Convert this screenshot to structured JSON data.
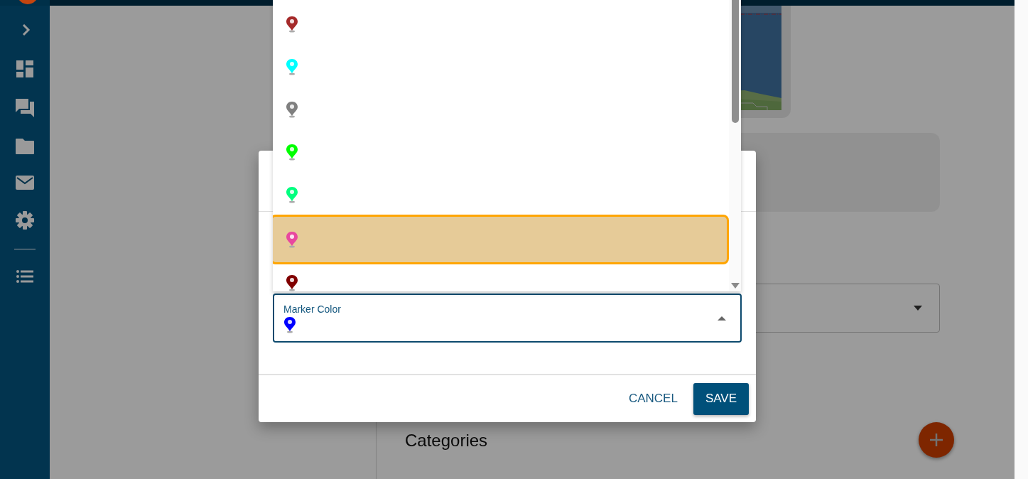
{
  "page": {
    "heading": "Categories"
  },
  "marker_dialog": {
    "options": [
      {
        "color": "#a52a2a",
        "selected": false,
        "highlighted": false
      },
      {
        "color": "#00ffff",
        "selected": false,
        "highlighted": false
      },
      {
        "color": "#808080",
        "selected": false,
        "highlighted": false
      },
      {
        "color": "#00ff00",
        "selected": false,
        "highlighted": false
      },
      {
        "color": "#00ff7f",
        "selected": false,
        "highlighted": false
      },
      {
        "color": "#e8489f",
        "selected": false,
        "highlighted": true
      },
      {
        "color": "#800000",
        "selected": false,
        "highlighted": false
      }
    ],
    "field": {
      "label": "Marker Color",
      "color": "#0000ff",
      "expanded": true
    },
    "buttons": [
      {
        "label": "CANCEL",
        "kind": "text"
      },
      {
        "label": "SAVE",
        "kind": "primary"
      }
    ]
  }
}
